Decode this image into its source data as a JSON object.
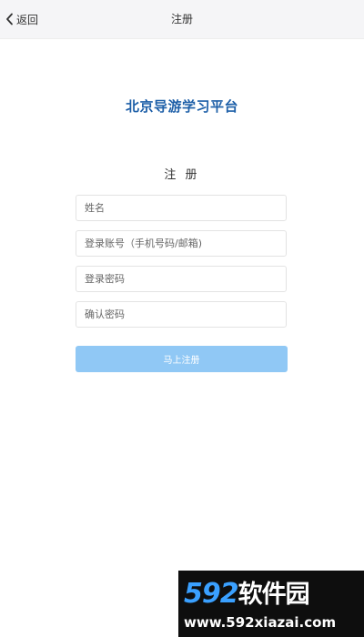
{
  "navbar": {
    "back_label": "返回",
    "title": "注册"
  },
  "brand": {
    "title": "北京导游学习平台"
  },
  "form": {
    "title": "注 册",
    "name_placeholder": "姓名",
    "account_placeholder": "登录账号（手机号码/邮箱)",
    "password_placeholder": "登录密码",
    "confirm_placeholder": "确认密码",
    "submit_label": "马上注册"
  },
  "watermark": {
    "logo_number": "592",
    "logo_name": "软件园",
    "url": "www.592xiazai.com"
  },
  "colors": {
    "brand": "#1d5fa8",
    "button": "#90c8f5",
    "navbar_bg": "#f5f5f7"
  },
  "icons": {
    "back": "chevron-left-icon"
  }
}
